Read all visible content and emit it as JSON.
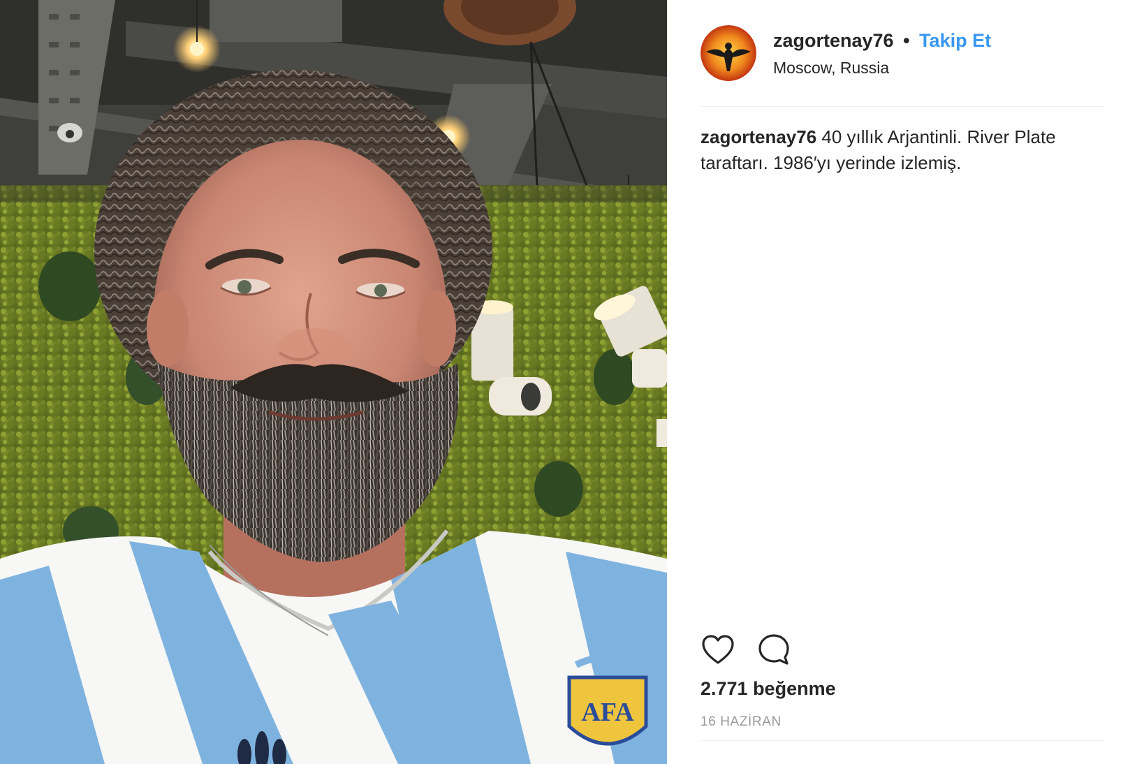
{
  "post": {
    "username": "zagortenay76",
    "separator": "•",
    "follow_label": "Takip Et",
    "location": "Moscow, Russia",
    "caption_user": "zagortenay76",
    "caption_text": " 40 yıllık Arjantinli. River Plate taraftarı. 1986′yı yerinde izlemiş.",
    "likes": "2.771 beğenme",
    "date": "16 HAZİRAN"
  },
  "actions": {
    "like_icon": "heart-icon",
    "comment_icon": "comment-bubble-icon"
  },
  "colors": {
    "follow_blue": "#3897f0",
    "text_dark": "#262626",
    "muted_gray": "#999999",
    "divider": "#efefef"
  }
}
